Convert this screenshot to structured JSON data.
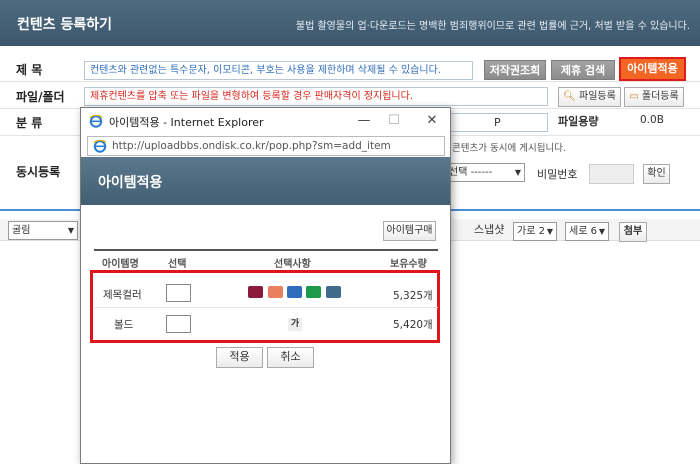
{
  "header": {
    "title": "컨텐츠 등록하기",
    "notice": "불법 촬영물의 업·다운로드는 명백한 범죄행위이므로 관련 법률에 근거, 처벌 받을 수 있습니다."
  },
  "form": {
    "title_label": "제  목",
    "title_placeholder": "컨텐츠와 관련없는 특수문자, 이모티콘, 부호는 사용을 제한하며 삭제될 수 있습니다.",
    "copyright_button": "저작권조회",
    "partner_button": "제휴 검색",
    "item_apply_button": "아이템적용",
    "file_label": "파일/폴더",
    "file_warning": "제휴컨텐츠를 압축 또는 파일을 변형하여 등록할 경우 판매자격이 정지됩니다.",
    "file_register_button": "파일등록",
    "folder_register_button": "폴더등록",
    "category_label": "분  류",
    "category_p": "P",
    "file_size_label": "파일용량",
    "file_size_value": "0.0B",
    "sync_notice": "콘텐츠가 동시에 게시됩니다.",
    "sync_label": "동시등록",
    "sync_select": "선택 ------",
    "password_label": "비밀번호",
    "confirm_button": "확인"
  },
  "toolbar": {
    "font_select": "굴림",
    "screenshot_label": "스냅샷",
    "horizontal_select": "가로 2",
    "vertical_select": "세로 6",
    "attach_button": "첨부"
  },
  "popup": {
    "window_title": "아이템적용 - Internet Explorer",
    "url": "http://uploadbbs.ondisk.co.kr/pop.php?sm=add_item",
    "heading": "아이템적용",
    "buy_button": "아이템구매",
    "columns": [
      "아이템명",
      "선택",
      "선택사항",
      "보유수량"
    ],
    "items": [
      {
        "name": "제목컬러",
        "quantity": "5,325개"
      },
      {
        "name": "볼드",
        "bold_sample": "가",
        "quantity": "5,420개"
      }
    ],
    "colors": [
      "#8b1a3c",
      "#e97f5f",
      "#2f6dbd",
      "#1e9a4a",
      "#3f6a8a"
    ],
    "apply_button": "적용",
    "cancel_button": "취소"
  }
}
